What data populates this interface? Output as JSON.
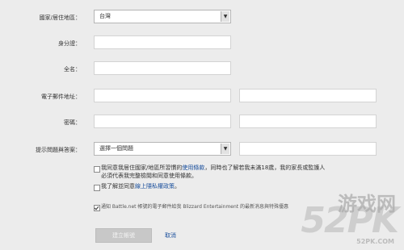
{
  "form": {
    "country_label": "國家/居住地區：",
    "country_value": "台灣",
    "id_label": "身分證：",
    "fullname_label": "全名：",
    "email_label": "電子郵件地址：",
    "password_label": "密碼：",
    "security_label": "提示問題與答案：",
    "security_select_value": "選擇一個問題"
  },
  "agreements": {
    "line1_prefix": "我同意我居住國家/地區所習慣的",
    "line1_link": "使用條款",
    "line1_suffix": "，同時也了解若我未滿18歲，我的家長或監護人",
    "line2": "必須代表我完整檢閱和同意使用條款。",
    "privacy_prefix": "我了解並同意",
    "privacy_link": "線上隱私權政策",
    "privacy_suffix": "。",
    "newsletter": "通知 Battle.net 帳號的電子郵件給我 Blizzard Entertainment 的最新消息與特殊優惠"
  },
  "buttons": {
    "submit": "建立帳號",
    "cancel": "取消"
  },
  "watermark": {
    "logo": "52PK",
    "tagline": "游戏网",
    "url": "52PK.COM"
  }
}
